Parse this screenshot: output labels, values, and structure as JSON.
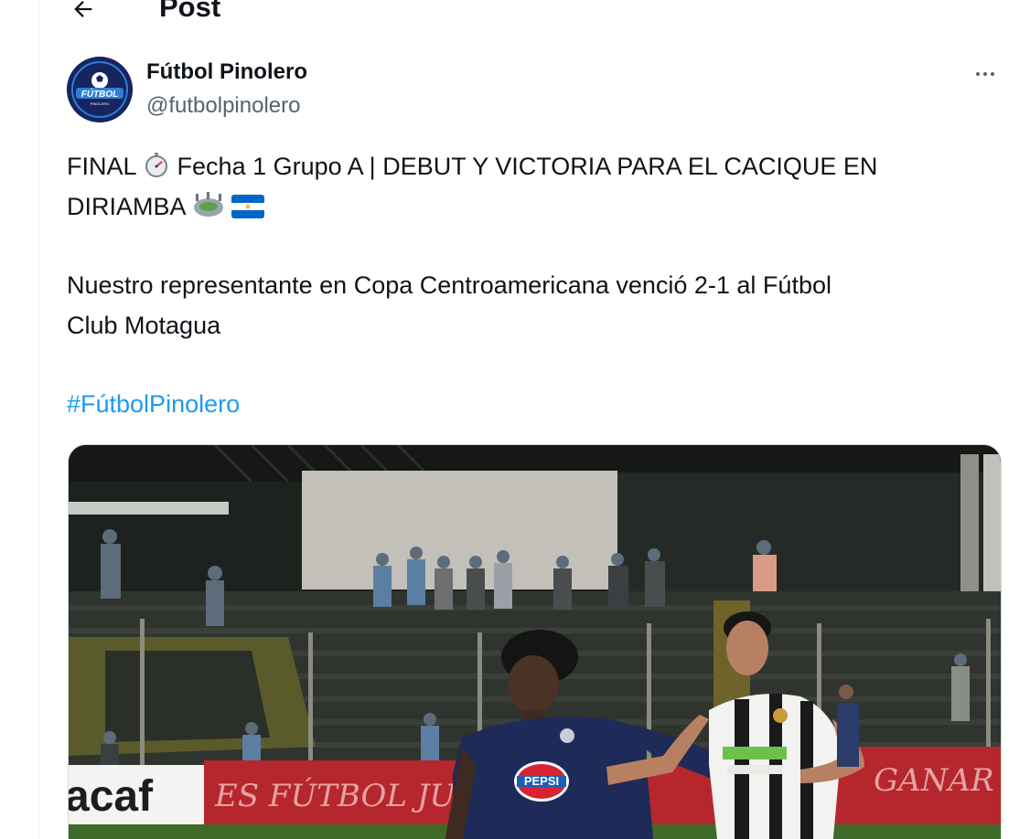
{
  "header": {
    "back_icon": "arrow-left-icon",
    "title": "Post"
  },
  "author": {
    "name": "Fútbol Pinolero",
    "handle": "@futbolpinolero",
    "avatar_text": "FÚTBOL",
    "avatar_subtext": "PINOLERO"
  },
  "more_icon": "more-horizontal-icon",
  "tweet": {
    "line1_a": "FINAL",
    "line1_b": "Fecha 1 Grupo A | DEBUT Y VICTORIA PARA EL CACIQUE EN",
    "line2": "DIRIAMBA",
    "para2_line1": "Nuestro representante en Copa Centroamericana venció 2-1 al Fútbol",
    "para2_line2": "Club Motagua",
    "hashtag": "#FútbolPinolero",
    "emojis": [
      "stopwatch-emoji",
      "stadium-emoji",
      "nicaragua-flag-emoji"
    ]
  },
  "media": {
    "description_icon": "photo-soccer-match",
    "ad_board_left": "acaf",
    "ad_board_mid": "ES FÚTBOL JUG",
    "ad_board_right": "GANAR AQ",
    "jersey_sponsor": "PEPSI",
    "colors": {
      "home_kit": "#1e2a57",
      "away_kit_stripe": "#1a1a1a",
      "pitch": "#3f6b2a",
      "board_red": "#b5272d"
    }
  }
}
